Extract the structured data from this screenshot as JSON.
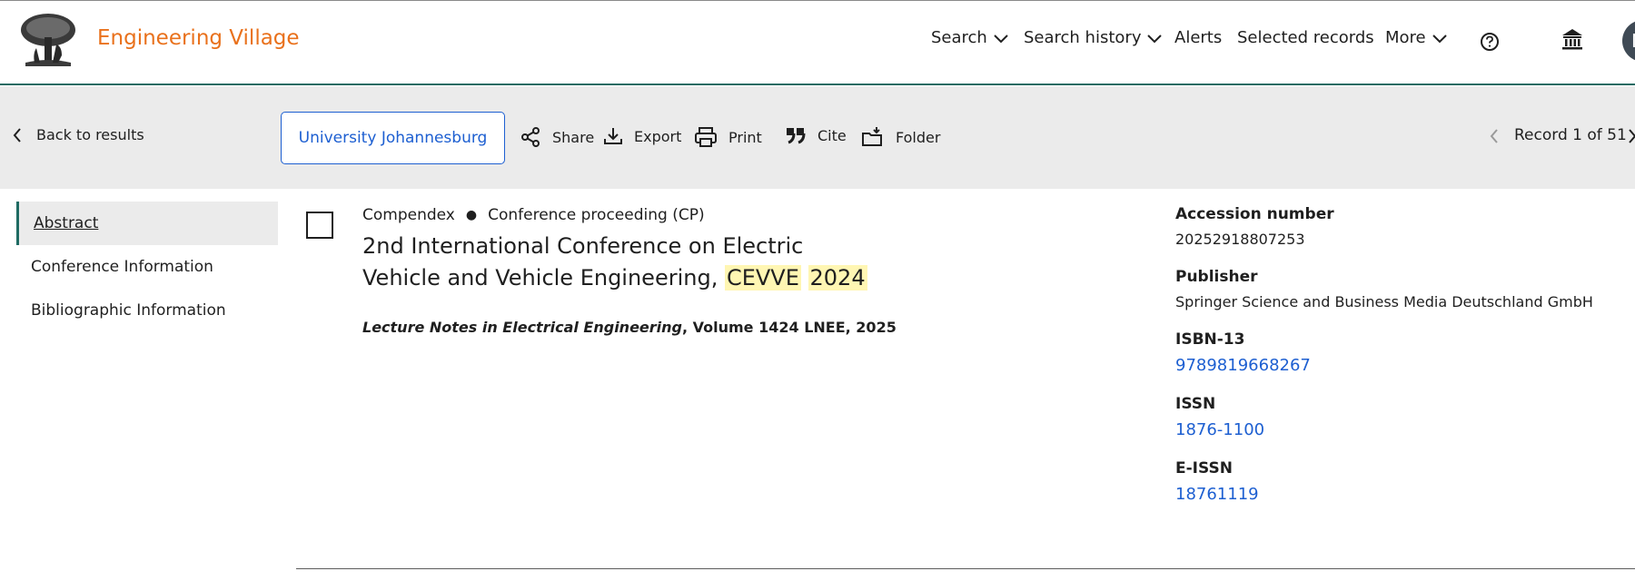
{
  "header": {
    "brand": "Engineering Village",
    "nav": {
      "search": "Search",
      "search_history": "Search history",
      "alerts": "Alerts",
      "selected_records": "Selected records",
      "more": "More"
    },
    "avatar_initial": "N"
  },
  "toolbar": {
    "back": "Back to results",
    "institution": "University Johannesburg",
    "share": "Share",
    "export": "Export",
    "print": "Print",
    "cite": "Cite",
    "folder": "Folder",
    "record_position": "Record 1 of 51"
  },
  "sidebar": {
    "items": [
      {
        "label": "Abstract"
      },
      {
        "label": "Conference Information"
      },
      {
        "label": "Bibliographic Information"
      }
    ]
  },
  "record": {
    "database": "Compendex",
    "doc_type": "Conference proceeding (CP)",
    "title_plain": "2nd International Conference on Electric Vehicle and Vehicle Engineering, ",
    "title_highlight_1": "CEVVE",
    "title_highlight_2": "2024",
    "source_series": "Lecture Notes in Electrical Engineering",
    "source_rest": ", Volume 1424 LNEE, 2025"
  },
  "details": {
    "accession_label": "Accession number",
    "accession_value": "20252918807253",
    "publisher_label": "Publisher",
    "publisher_value": "Springer Science and Business Media Deutschland GmbH",
    "isbn_label": "ISBN-13",
    "isbn_value": "9789819668267",
    "issn_label": "ISSN",
    "issn_value": "1876-1100",
    "eissn_label": "E-ISSN",
    "eissn_value": "18761119"
  },
  "colors": {
    "brand": "#e9711c",
    "accent_teal": "#1f6b63",
    "link": "#1d5fd1",
    "toolbar_bg": "#ebebeb",
    "highlight": "#fff6b3"
  }
}
